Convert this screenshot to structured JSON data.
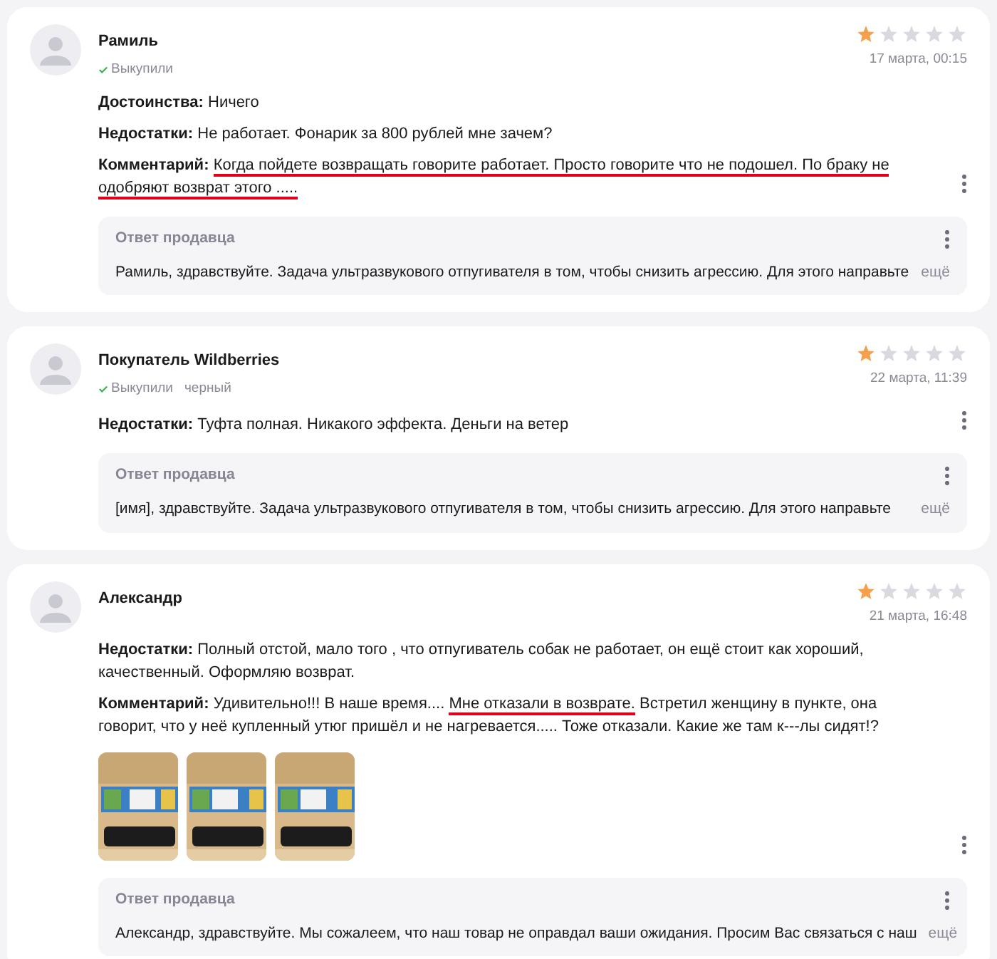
{
  "reviews": [
    {
      "author": "Рамиль",
      "badges": [
        {
          "kind": "bought",
          "text": "Выкупили"
        }
      ],
      "stars": 1,
      "date": "17 марта, 00:15",
      "fields": [
        {
          "label": "Достоинства:",
          "parts": [
            {
              "text": "Ничего",
              "marked": false
            }
          ]
        },
        {
          "label": "Недостатки:",
          "parts": [
            {
              "text": "Не работает. Фонарик за 800 рублей мне зачем?",
              "marked": false
            }
          ]
        },
        {
          "label": "Комментарий:",
          "parts": [
            {
              "text": "Когда пойдете возвращать говорите работает. Просто говорите что не подошел. По браку не одобряют возврат этого .....",
              "marked": true
            }
          ]
        }
      ],
      "reply": {
        "title": "Ответ продавца",
        "text": "Рамиль, здравствуйте. Задача ультразвукового отпугивателя в том, чтобы снизить агрессию. Для этого направьте",
        "more": "ещё"
      }
    },
    {
      "author": "Покупатель Wildberries",
      "badges": [
        {
          "kind": "bought",
          "text": "Выкупили"
        },
        {
          "kind": "variant",
          "text": "черный"
        }
      ],
      "stars": 1,
      "date": "22 марта, 11:39",
      "fields": [
        {
          "label": "Недостатки:",
          "parts": [
            {
              "text": "Туфта полная. Никакого эффекта. Деньги на ветер",
              "marked": false
            }
          ]
        }
      ],
      "reply": {
        "title": "Ответ продавца",
        "text": "[имя], здравствуйте. Задача ультразвукового отпугивателя в том, чтобы снизить агрессию. Для этого направьте",
        "more": "ещё"
      }
    },
    {
      "author": "Александр",
      "stars": 1,
      "date": "21 марта, 16:48",
      "fields": [
        {
          "label": "Недостатки:",
          "parts": [
            {
              "text": "Полный отстой, мало того , что отпугиватель собак не работает, он ещё стоит как хороший, качественный. Оформляю возврат.",
              "marked": false
            }
          ]
        },
        {
          "label": "Комментарий:",
          "parts": [
            {
              "text": "Удивительно!!! В наше время.... ",
              "marked": false
            },
            {
              "text": "Мне отказали в возврате.",
              "marked": true
            },
            {
              "text": " Встретил женщину в пункте, она говорит, что у неё купленный утюг пришёл и не нагревается..... Тоже отказали. Какие же там к---лы сидят!?",
              "marked": false
            }
          ]
        }
      ],
      "photos": [
        {
          "kind": "picture"
        },
        {
          "kind": "picture"
        },
        {
          "kind": "picture"
        }
      ],
      "reply": {
        "title": "Ответ продавца",
        "text": "Александр, здравствуйте. Мы сожалеем, что наш товар не оправдал ваши ожидания. Просим Вас связаться с наш",
        "more": "ещё"
      }
    }
  ]
}
